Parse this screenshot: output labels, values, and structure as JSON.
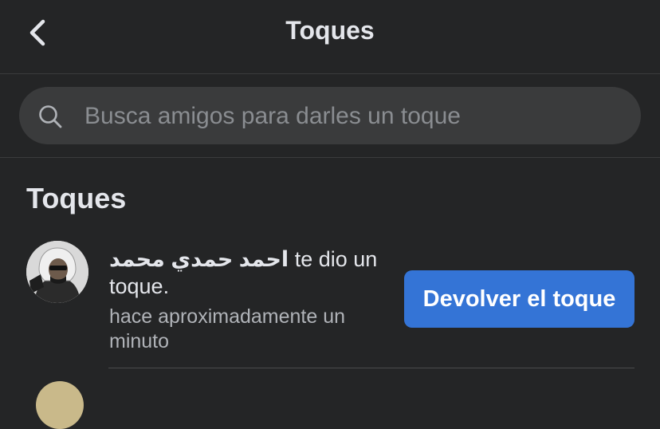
{
  "header": {
    "title": "Toques",
    "back_icon": "chevron-left-icon"
  },
  "search": {
    "placeholder": "Busca amigos para darles un toque",
    "icon": "search-icon"
  },
  "section": {
    "title": "Toques"
  },
  "pokes": [
    {
      "name": "احمد حمدي محمد",
      "action": " te dio un toque.",
      "time": "hace aproximadamente un minuto",
      "button_label": "Devolver el toque"
    }
  ],
  "colors": {
    "background": "#242526",
    "search_bg": "#3a3b3c",
    "accent": "#3474d6",
    "text_primary": "#e4e6eb",
    "text_secondary": "#b0b3b8"
  }
}
